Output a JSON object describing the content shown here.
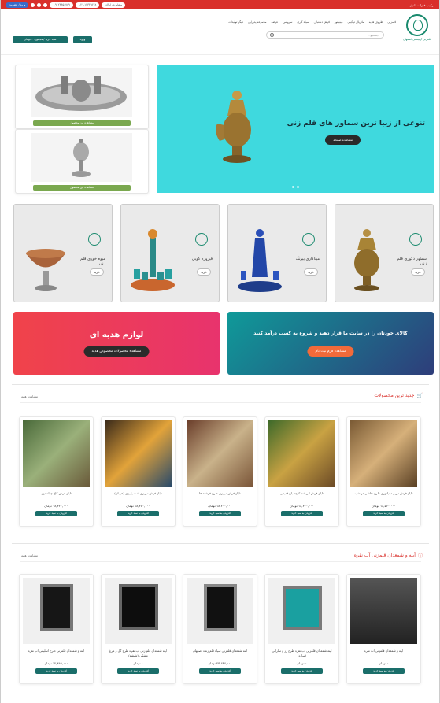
{
  "topbar": {
    "tagline": "ترکیب فلزات، انیاژ",
    "pills": [
      "۰۹۱۲۳۴۵۶۷۸۹",
      "۰۲۱-۱۲۳۴۵۶۷۸",
      "مشاوره رایگان"
    ],
    "blue_pill": "ورود / عضویت"
  },
  "header": {
    "logo_text": "قلمزنی آرتیستی اصفهان",
    "nav": [
      "قلمزنی",
      "ظروف هدیه",
      "ماتریال ترکیبی",
      "مینیاتور",
      "فرش دستباف",
      "سیاه کاری",
      "سرویس",
      "عرضه",
      "مجموعه پذیرایی",
      "دیگر تولیدات"
    ],
    "search_placeholder": "جستجو...",
    "cart_label": "سبد خرید / مجموع: ۰ تومان",
    "login_label": "ورود"
  },
  "hero": {
    "title": "تنوعی از زیبا ترین سماور های قلم زنی",
    "button": "مشاهده صفحه"
  },
  "side_cards": [
    {
      "button": "مشاهده این محصول"
    },
    {
      "button": "مشاهده این محصول"
    }
  ],
  "categories": [
    {
      "label": "سماور دکوری قلم زنی",
      "buy": "خرید"
    },
    {
      "label": "میناکاری پیونگ",
      "buy": "خرید"
    },
    {
      "label": "فیروزه کوبی",
      "buy": "خرید"
    },
    {
      "label": "میوه خوری قلم زنی",
      "buy": "خرید"
    }
  ],
  "promos": {
    "seller": {
      "title": "کالای خودتان را در سایت ما قرار دهید و شروع به کسب درآمد کنید",
      "button": "مشاهده فرم ثبت نام"
    },
    "gift": {
      "title": "لوازم هدیه ای",
      "button": "مشاهده محصولات مخصوص هدیه"
    }
  },
  "section_new": {
    "title": "جدید ترین محصولات",
    "more": "مشاهده همه",
    "products": [
      {
        "name": "تابلو فرش تبریز مینیاتوری طرح نقاشی در شب",
        "price": "۱۸,۵۶۰,۰۰۰ تومان",
        "btn": "افزودن به سبد خرید"
      },
      {
        "name": "تابلو فرش ابریشم کوچه باغ قدیمی",
        "price": "۱۸,۳۲۰,۰۰۰ تومان",
        "btn": "افزودن به سبد خرید"
      },
      {
        "name": "تابلو فرش تبریزی طرح فرشته ها",
        "price": "۱۸,۲۰۰,۰۰۰ تومان",
        "btn": "افزودن به سبد خرید"
      },
      {
        "name": "تابلو فرش تبریزی شب پاییزی (خیابان)",
        "price": "۱۸,۴۷۰,۰۰۰ تومان",
        "btn": "افزودن به سبد خرید"
      },
      {
        "name": "تابلو فرش کاخ چهلستون",
        "price": "۱۸,۳۲۰,۰۰۰ تومان",
        "btn": "افزودن به سبد خرید"
      }
    ]
  },
  "section_mirror": {
    "title": "آینه و شمعدان قلمزنی آب نقره",
    "more": "مشاهده همه",
    "products": [
      {
        "name": "آینه و شمعدان قلمزنی آب نقره",
        "price": "۰ تومان",
        "btn": "افزودن به سبد خرید"
      },
      {
        "name": "آینه شمعدان قلمزنی آب نقره طرح رز و سارانی (ساده)",
        "price": "۰ تومان",
        "btn": "افزودن به سبد خرید"
      },
      {
        "name": "آینه شمعدان قلمزنی سیاه قلم زنده اصفهان",
        "price": "۲۳,۶۳۶,۰۰۰ تومان",
        "btn": "افزودن به سبد خرید"
      },
      {
        "name": "آینه شمعدان قلم زنی آب نقره طرح گل و مرغ مشکی (شیشه)",
        "price": "۰ تومان",
        "btn": "افزودن به سبد خرید"
      },
      {
        "name": "آینه و شمعدان قلمزنی طرح اسلیمی آب نقره",
        "price": "۱۲,۴۸۸,۰۰۰ تومان",
        "btn": "افزودن به سبد خرید"
      }
    ]
  }
}
